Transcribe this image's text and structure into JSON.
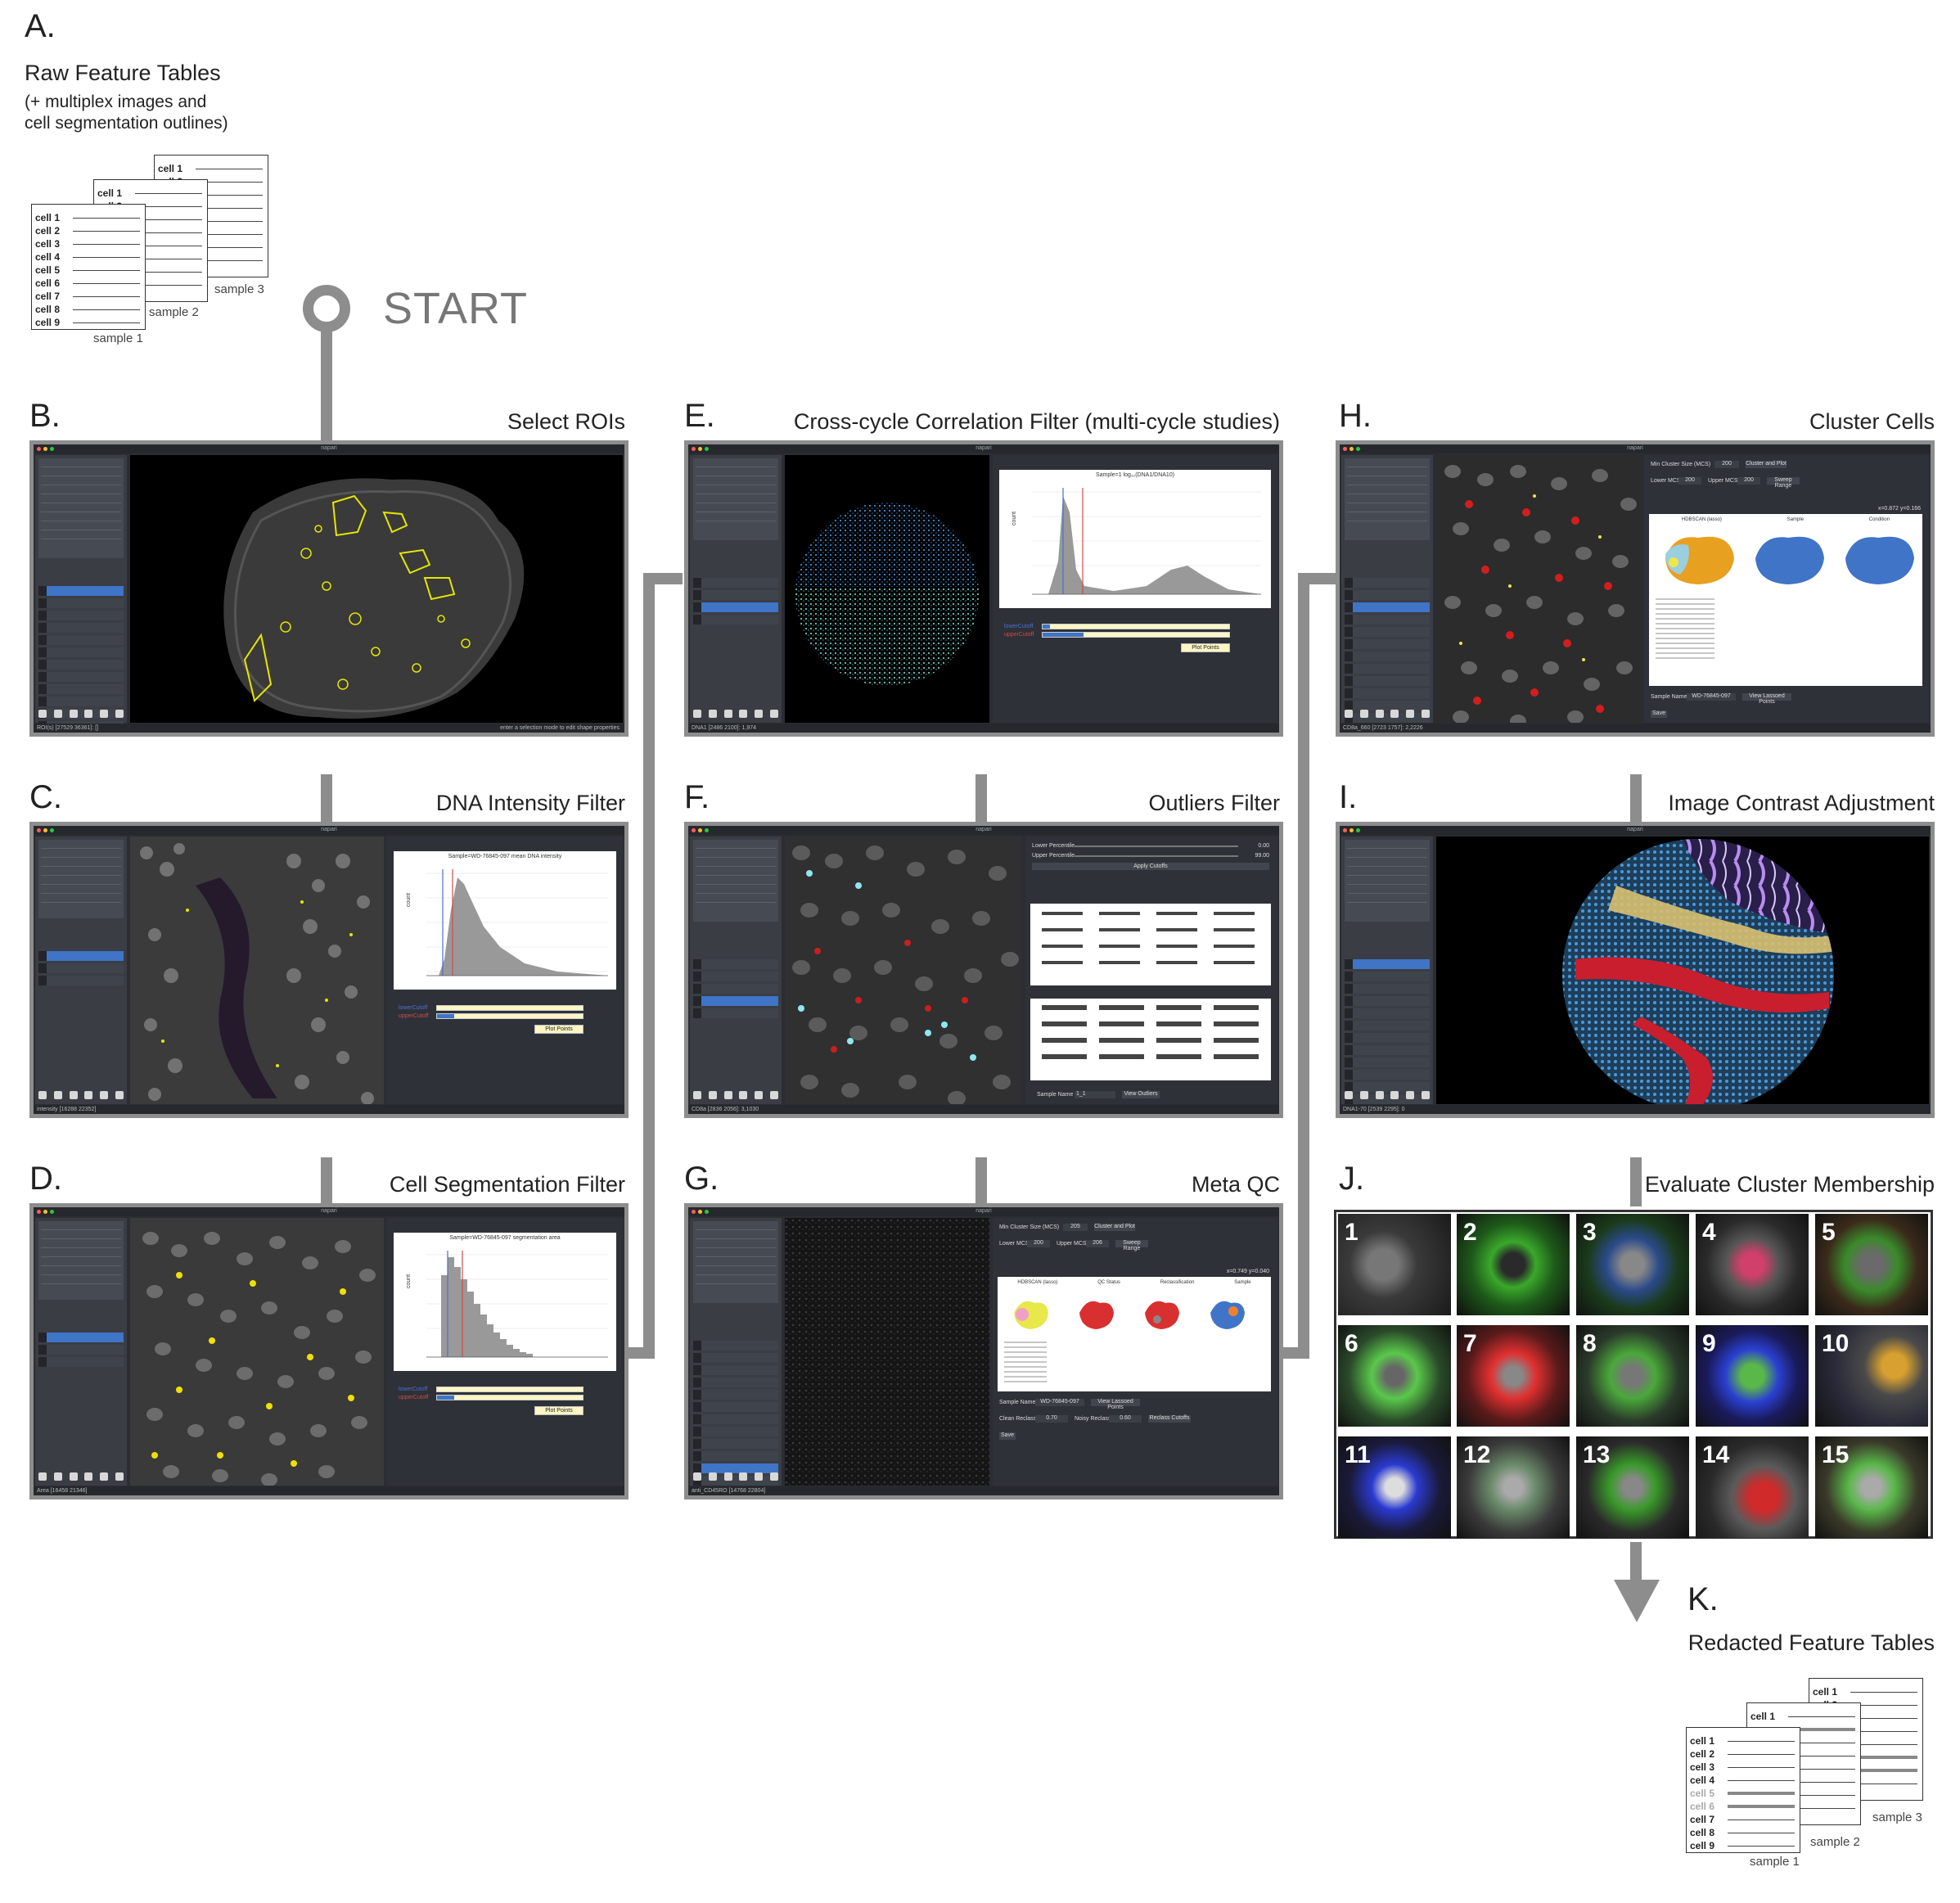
{
  "steps": {
    "A": {
      "letter": "A.",
      "title": "Raw Feature Tables",
      "sub1": "(+ multiplex images and",
      "sub2": "cell segmentation outlines)"
    },
    "B": {
      "letter": "B.",
      "title": "Select ROIs"
    },
    "C": {
      "letter": "C.",
      "title": "DNA Intensity Filter"
    },
    "D": {
      "letter": "D.",
      "title": "Cell Segmentation Filter"
    },
    "E": {
      "letter": "E.",
      "title": "Cross-cycle Correlation Filter (multi-cycle studies)"
    },
    "F": {
      "letter": "F.",
      "title": "Outliers Filter"
    },
    "G": {
      "letter": "G.",
      "title": "Meta QC"
    },
    "H": {
      "letter": "H.",
      "title": "Cluster Cells"
    },
    "I": {
      "letter": "I.",
      "title": "Image Contrast Adjustment"
    },
    "J": {
      "letter": "J.",
      "title": "Evaluate Cluster Membership"
    },
    "K": {
      "letter": "K.",
      "title": "Redacted Feature Tables"
    }
  },
  "start_label": "START",
  "raw_tables": {
    "sample1_label": "sample 1",
    "sample2_label": "sample 2",
    "sample3_label": "sample 3",
    "cells": [
      "cell 1",
      "cell 2",
      "cell 3",
      "cell 4",
      "cell 5",
      "cell 6",
      "cell 7",
      "cell 8",
      "cell 9"
    ]
  },
  "redacted_tables": {
    "sample1_label": "sample 1",
    "sample2_label": "sample 2",
    "sample3_label": "sample 3",
    "cells": [
      "cell 1",
      "cell 2",
      "cell 3",
      "cell 4",
      "cell 5",
      "cell 6",
      "cell 7",
      "cell 8",
      "cell 9"
    ],
    "redacted_rows": [
      4,
      5
    ]
  },
  "panels": {
    "B": {
      "window_title": "napari",
      "status": "ROI(s) [27529 36361]: []",
      "status_right": "enter a selection mode to edit shape properties"
    },
    "C": {
      "window_title": "napari",
      "status": "intensity [16288 22352]",
      "plot_title": "Sample=WD-76845-097 mean DNA intensity",
      "y_label": "count",
      "lower_label": "lowerCutoff",
      "upper_label": "upperCutoff",
      "lower_value": "35",
      "upper_value": "5646",
      "button": "Plot Points"
    },
    "D": {
      "window_title": "napari",
      "status": "Area [16458 21346]",
      "plot_title": "Sample=WD-76845-097 segmentation area",
      "y_label": "count",
      "lower_label": "lowerCutoff",
      "upper_label": "upperCutoff",
      "lower_value": "19",
      "upper_value": "40",
      "button": "Plot Points"
    },
    "E": {
      "window_title": "napari",
      "status": "DNA1 [2486 2100]: 1,974",
      "plot_title": "Sample=1 log₁₀(DNA1/DNA10)",
      "y_label": "count",
      "lower_label": "lowerCutoff",
      "upper_label": "upperCutoff",
      "button": "Plot Points"
    },
    "F": {
      "window_title": "napari",
      "status": "CD8a [2836 2056]: 3,1030",
      "lower_pct_label": "Lower Percentile",
      "upper_pct_label": "Upper Percentile",
      "lower_pct": "0.00",
      "upper_pct": "99.00",
      "apply_button": "Apply Cutoffs",
      "sample_name_label": "Sample Name",
      "sample_name_value": "1_1",
      "view_button": "View Outliers"
    },
    "G": {
      "window_title": "napari",
      "status": "anti_CD45RO [14768 22804]",
      "min_cluster_label": "Min Cluster Size (MCS)",
      "min_cluster_value": "205",
      "cluster_button": "Cluster and Plot",
      "lower_mcs_label": "Lower MCS",
      "lower_mcs_value": "200",
      "upper_mcs_label": "Upper MCS",
      "upper_mcs_value": "206",
      "sweep_button": "Sweep Range",
      "coords": "x=0.749 y=0.040",
      "plot_titles": [
        "HDBSCAN (lasso)",
        "QC Status",
        "Reclassification",
        "Sample"
      ],
      "sample_name_label": "Sample Name",
      "sample_name_value": "WD-76845-097",
      "view_button": "View Lassoed Points",
      "clean_label": "Clean Reclass",
      "clean_value": "0.70",
      "noisy_label": "Noisy Reclass",
      "noisy_value": "0.60",
      "reclass_button": "Reclass Cutoffs",
      "save_button": "Save"
    },
    "H": {
      "window_title": "napari",
      "status": "CD8a_660 [2723 1757]: 2,2226",
      "min_cluster_label": "Min Cluster Size (MCS)",
      "min_cluster_value": "200",
      "cluster_button": "Cluster and Plot",
      "lower_mcs_label": "Lower MCS",
      "lower_mcs_value": "200",
      "upper_mcs_label": "Upper MCS",
      "upper_mcs_value": "200",
      "sweep_button": "Sweep Range",
      "coords": "x=0.872 y=0.166",
      "plot_titles": [
        "HDBSCAN (lasso)",
        "Sample",
        "Condition"
      ],
      "sample_name_label": "Sample Name",
      "sample_name_value": "WD-76845-097",
      "view_button": "View Lassoed Points",
      "save_button": "Save"
    },
    "I": {
      "window_title": "napari",
      "status": "DNA1-70 [2539 2295]: 0"
    }
  },
  "tiles": [
    "1",
    "2",
    "3",
    "4",
    "5",
    "6",
    "7",
    "8",
    "9",
    "10",
    "11",
    "12",
    "13",
    "14",
    "15"
  ],
  "colors": {
    "track": "#8d8d8d",
    "panel_bg": "#2b2d33",
    "accent_blue": "#3f74c7",
    "roi_yellow": "#e6e600"
  }
}
